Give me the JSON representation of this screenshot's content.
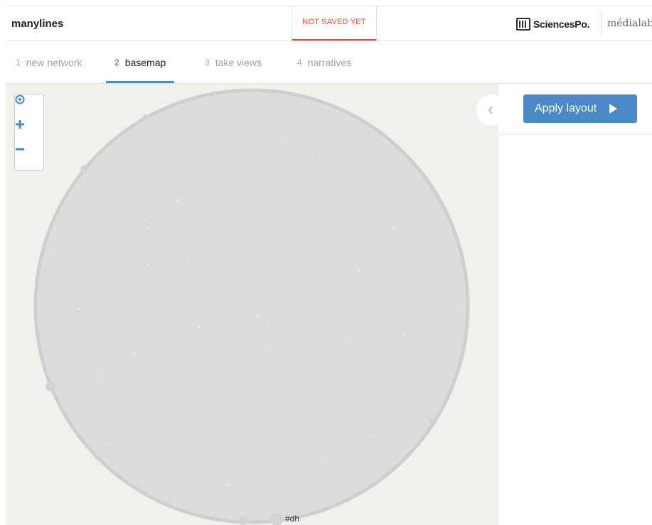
{
  "app": {
    "name": "manylines",
    "save_status": "NOT SAVED YET",
    "partner_logo_1": "SciencesPo.",
    "partner_logo_2": "médialab"
  },
  "steps": [
    {
      "number": "1",
      "label": "new network",
      "active": false
    },
    {
      "number": "2",
      "label": "basemap",
      "active": true
    },
    {
      "number": "3",
      "label": "take views",
      "active": false
    },
    {
      "number": "4",
      "label": "narratives",
      "active": false
    }
  ],
  "map": {
    "controls": {
      "locate_icon": "target-icon",
      "zoom_in_icon": "plus-icon",
      "zoom_out_icon": "minus-icon"
    },
    "node_label": "#dh",
    "colors": {
      "background": "#f2f0eb",
      "network_fill": "#dcdcdc",
      "network_edge": "#cfcfcf"
    }
  },
  "panel": {
    "collapse_icon": "chevron-left-icon",
    "apply_button_label": "Apply layout",
    "apply_button_icon": "play-icon",
    "accent_color": "#4a89c8"
  }
}
